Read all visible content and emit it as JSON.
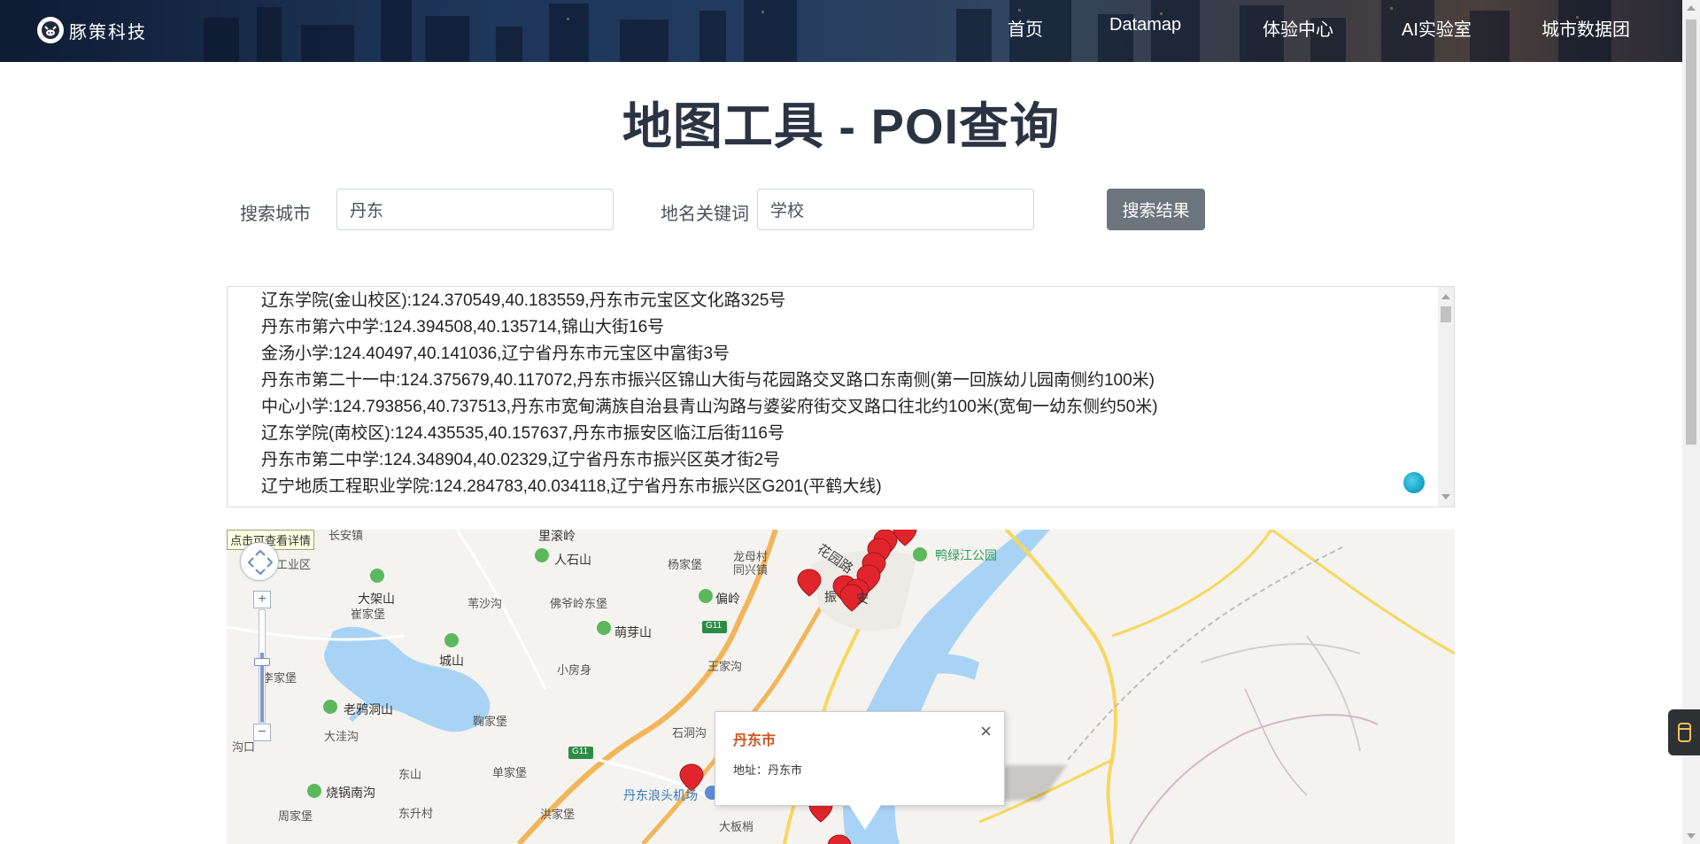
{
  "brand": {
    "name": "豚策科技"
  },
  "nav": {
    "items": [
      {
        "label": "首页"
      },
      {
        "label": "Datamap"
      },
      {
        "label": "体验中心"
      },
      {
        "label": "AI实验室"
      },
      {
        "label": "城市数据团"
      }
    ]
  },
  "page": {
    "title": "地图工具 - POI查询"
  },
  "search": {
    "city_label": "搜索城市",
    "city_value": "丹东",
    "keyword_label": "地名关键词",
    "keyword_value": "学校",
    "button_label": "搜索结果"
  },
  "results": [
    "辽东学院(金山校区):124.370549,40.183559,丹东市元宝区文化路325号",
    "丹东市第六中学:124.394508,40.135714,锦山大街16号",
    "金汤小学:124.40497,40.141036,辽宁省丹东市元宝区中富街3号",
    "丹东市第二十一中:124.375679,40.117072,丹东市振兴区锦山大街与花园路交叉路口东南侧(第一回族幼儿园南侧约100米)",
    "中心小学:124.793856,40.737513,丹东市宽甸满族自治县青山沟路与婆娑府街交叉路口往北约100米(宽甸一幼东侧约50米)",
    "辽东学院(南校区):124.435535,40.157637,丹东市振安区临江后街116号",
    "丹东市第二中学:124.348904,40.02329,辽宁省丹东市振兴区英才街2号",
    "辽宁地质工程职业学院:124.284783,40.034118,辽宁省丹东市振兴区G201(平鹤大线)"
  ],
  "map": {
    "tooltip": "点击可查看详情",
    "zoom_in": "+",
    "zoom_out": "−",
    "popup": {
      "title": "丹东市",
      "address": "地址：丹东市",
      "close": "×"
    },
    "labels": {
      "changanzhen": "长安镇",
      "gongyequ": "工业区",
      "liguanling": "里滚岭",
      "renshishan": "人石山",
      "longmu": "龙母村",
      "tongxingzhen": "同兴镇",
      "yangjiapu": "杨家堡",
      "huayuanlu": "花园路",
      "yalujiang": "鸭绿江公园",
      "dajiashan": "大架山",
      "cuijiapu": "崔家堡",
      "weishawa": "苇沙沟",
      "foyelingdong": "佛爷岭东堡",
      "pianling": "偏岭",
      "zhen": "振",
      "an": "安",
      "chengshan": "城山",
      "mengyashan": "萌芽山",
      "lijiapu": "李家堡",
      "xiaofangshen": "小房身",
      "wangjiagou": "王家沟",
      "laoyadong": "老鸦洞山",
      "dawagou": "大洼沟",
      "jujiapu": "鞠家堡",
      "shidonggou": "石洞沟",
      "gougou": "沟口",
      "dongshan": "东山",
      "danjiapu": "单家堡",
      "shaoguonan": "烧锅南沟",
      "zhoujiapu": "周家堡",
      "dongshengcun": "东升村",
      "hongjiapu": "洪家堡",
      "airport": "丹东浪头机场",
      "dabanshao": "大板梢",
      "g11a": "G11",
      "g11b": "G11"
    }
  }
}
